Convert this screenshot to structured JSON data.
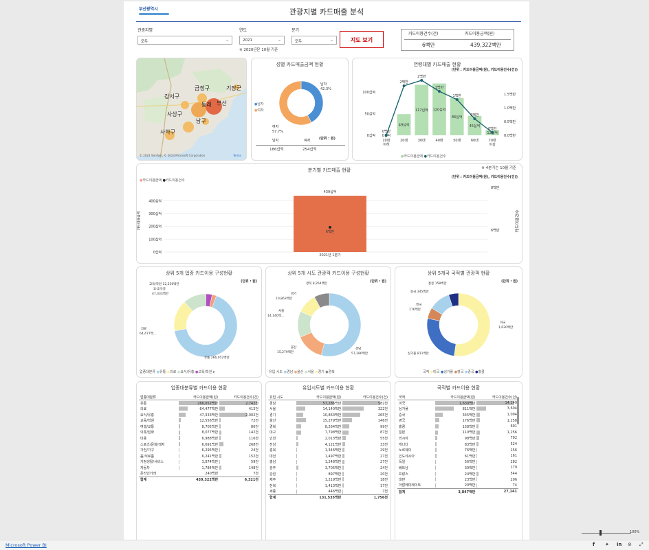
{
  "header": {
    "logo_text": "부산광역시",
    "title": "관광지별 카드매출 분석"
  },
  "filters": {
    "region_label": "관광지명",
    "region_value": "모두",
    "year_label": "연도",
    "year_value": "2021",
    "year_note": "※ 2020년은 10월 기준",
    "quarter_label": "분기",
    "quarter_value": "모두",
    "map_button": "지도 보기"
  },
  "kpi": {
    "count_label": "카드이용건수(건)",
    "amount_label": "카드이용금액(원)",
    "count_value": "6백만",
    "amount_value": "439,322백만"
  },
  "map": {
    "labels": [
      "기장군",
      "금정구",
      "강서구",
      "동래",
      "부산",
      "사상구",
      "남구",
      "사하구"
    ],
    "credit": "© 2023 TomTom, © 2023 Microsoft Corporation",
    "terms": "Terms"
  },
  "gender": {
    "title": "성별 카드매출금액 현황",
    "unit": "(단위 : 원)",
    "legend": [
      "남자",
      "여자"
    ],
    "labels": [
      "남자",
      "42.3%",
      "여자",
      "57.7%"
    ],
    "table_head": [
      "남자",
      "여자"
    ],
    "table_vals": [
      "186십억",
      "254십억"
    ],
    "chart_data": {
      "type": "pie",
      "categories": [
        "남자",
        "여자"
      ],
      "values": [
        42.3,
        57.7
      ],
      "colors": [
        "#4a8fd4",
        "#f4a65e"
      ]
    }
  },
  "age": {
    "title": "연령대별 카드매출 현황",
    "unit": "(단위 : 카드이용금액(원), 카드이용건수(건))",
    "legend": [
      "카드이용금액",
      "카드이용건수"
    ],
    "yl": [
      "100십억",
      "50십억",
      "0십억"
    ],
    "yr": [
      "1.5백만",
      "1.0백만",
      "0.5백만",
      "0.0백만"
    ],
    "chart_data": {
      "type": "bar",
      "categories": [
        "10대\n이하",
        "20대",
        "30대",
        "40대",
        "50대",
        "60대",
        "70대\n이상"
      ],
      "cat_labels": [
        "10대",
        "20대",
        "30대",
        "40대",
        "50대",
        "60대",
        "70대"
      ],
      "cat_labels2": [
        "이하",
        "",
        "",
        "",
        "",
        "",
        "이상"
      ],
      "series": [
        {
          "name": "카드이용금액",
          "values": [
            0,
            49,
            117,
            120,
            86,
            45,
            12
          ],
          "labels": [
            "0십억",
            "49십억",
            "117십억",
            "120십억",
            "86십억",
            "45십억",
            "12십억"
          ]
        },
        {
          "name": "카드이용건수",
          "values": [
            0,
            1.8,
            2.0,
            1.6,
            1.3,
            0.6,
            0.1
          ],
          "labels": [
            "0백만",
            "2백만",
            "2백만",
            "1백만",
            "1백만",
            "0백만",
            "0백만"
          ]
        }
      ],
      "ylim": [
        0,
        140
      ],
      "y2lim": [
        0,
        2.2
      ]
    }
  },
  "quarter": {
    "title": "분기별 카드매출 현황",
    "note": "※ 4분기는 10월 기준",
    "unit": "(단위 : 카드이용금액(원), 카드이용건수(건))",
    "legend": [
      "카드이용금액",
      "카드이용건수"
    ],
    "ylabel": "카드이용금액",
    "y2label": "카드이용건수",
    "yl": [
      "400십억",
      "300십억",
      "200십억",
      "100십억",
      "0십억"
    ],
    "yr": [
      "8백만",
      "6백만"
    ],
    "chart_data": {
      "type": "bar",
      "categories": [
        "2021년 1분기"
      ],
      "series": [
        {
          "name": "카드이용금액",
          "values": [
            439
          ],
          "labels": [
            "439십억"
          ]
        },
        {
          "name": "카드이용건수",
          "values": [
            6
          ],
          "labels": [
            "6백만"
          ]
        }
      ],
      "ylim": [
        0,
        450
      ]
    }
  },
  "donut1": {
    "title": "상위 5개 업종 카드이용 구성현황",
    "unit": "(단위 : 원)",
    "legend_title": "업종대분류",
    "legend": [
      "유통",
      "의료",
      "요식/유흥",
      "교육/학원"
    ],
    "labels": [
      "교육/학원 12,556백만",
      "요식/유흥",
      "47,333백만",
      "의료",
      "64,477백...",
      "유통 266,052백만"
    ],
    "chart_data": {
      "type": "pie",
      "categories": [
        "유통",
        "의료",
        "요식/유흥",
        "교육/학원",
        "여행/교통"
      ],
      "values": [
        266052,
        64477,
        47333,
        12556,
        8705
      ],
      "colors": [
        "#a8d1ec",
        "#fbf2a4",
        "#cce3cc",
        "#b04fc0",
        "#f2a07b"
      ]
    }
  },
  "donut2": {
    "title": "상위 5개 시도 관광객 카드이용 구성현황",
    "unit": "(단위 : 원)",
    "legend_title": "유입 시도",
    "legend": [
      "경남",
      "울산",
      "서울",
      "경기",
      "경북"
    ],
    "labels": [
      "경북 8,264백만",
      "경기",
      "10,863백만",
      "서울",
      "14,140백...",
      "울산",
      "15,279백만",
      "경남",
      "57,286백만"
    ],
    "chart_data": {
      "type": "pie",
      "categories": [
        "경남",
        "울산",
        "서울",
        "경기",
        "경북"
      ],
      "values": [
        57286,
        15279,
        14140,
        10863,
        8264
      ],
      "colors": [
        "#a8d1ec",
        "#f4a97a",
        "#cce3cc",
        "#fbf2a4",
        "#8a8a8a"
      ]
    }
  },
  "donut3": {
    "title": "상위 5개국 국적별 관광객 현황",
    "unit": "(단위 : 원)",
    "legend_title": "국적",
    "legend": [
      "미국",
      "싱가폴",
      "영국",
      "중국",
      "홍콩"
    ],
    "labels": [
      "홍콩 158백만",
      "중국 345백만",
      "영국",
      "176백만",
      "미국",
      "1,630백만",
      "싱가폴 811백만"
    ],
    "chart_data": {
      "type": "pie",
      "categories": [
        "미국",
        "싱가폴",
        "영국",
        "중국",
        "홍콩"
      ],
      "values": [
        1630,
        811,
        176,
        345,
        158
      ],
      "colors": [
        "#fbf2a4",
        "#3f6fc2",
        "#d4885a",
        "#a8d1ec",
        "#1f2f86"
      ]
    }
  },
  "t1": {
    "title": "업종대분류별 카드이용 현황",
    "head": [
      "업종대분류",
      "카드이용금액(원)",
      "카드이용건수(건)"
    ],
    "rows": [
      [
        "유통",
        "266,052백만",
        "2,742천",
        100,
        100
      ],
      [
        "의료",
        "64,477백만",
        "413천",
        24,
        15
      ],
      [
        "요식/유흥",
        "47,333백만",
        "2,002천",
        18,
        73
      ],
      [
        "교육/학원",
        "12,556백만",
        "72천",
        5,
        3
      ],
      [
        "여행/교통",
        "8,705백만",
        "86천",
        3,
        3
      ],
      [
        "의류/잡화",
        "8,077백만",
        "142천",
        3,
        5
      ],
      [
        "미용",
        "6,988백만",
        "116천",
        3,
        4
      ],
      [
        "스포츠/문화/레저",
        "6,691백만",
        "268천",
        3,
        10
      ],
      [
        "가전/가구",
        "6,295백만",
        "24천",
        2,
        1
      ],
      [
        "음/식료품",
        "6,241백만",
        "152천",
        2,
        6
      ],
      [
        "가정생활/서비스",
        "3,874백만",
        "59천",
        1,
        2
      ],
      [
        "자동차",
        "1,784백만",
        "148천",
        1,
        5
      ],
      [
        "온라인거래",
        "240백만",
        "7천",
        0,
        0
      ]
    ],
    "total": [
      "합계",
      "439,322백만",
      "6,321천"
    ]
  },
  "t2": {
    "title": "유입시도별 카드이용 현황",
    "head": [
      "유입 시도",
      "카드이용금액(원)",
      "카드이용건수(건)"
    ],
    "rows": [
      [
        "경남",
        "57,286백만",
        "582천",
        100,
        100
      ],
      [
        "서울",
        "14,140백만",
        "322천",
        25,
        55
      ],
      [
        "경기",
        "10,863백만",
        "265천",
        19,
        46
      ],
      [
        "울산",
        "15,279백만",
        "146천",
        27,
        25
      ],
      [
        "경북",
        "8,264백만",
        "99천",
        14,
        17
      ],
      [
        "대구",
        "7,798백만",
        "87천",
        14,
        15
      ],
      [
        "인천",
        "2,013백만",
        "55천",
        4,
        9
      ],
      [
        "전남",
        "4,121백만",
        "33천",
        7,
        6
      ],
      [
        "충북",
        "1,346백만",
        "29천",
        2,
        5
      ],
      [
        "대전",
        "1,497백만",
        "27천",
        3,
        5
      ],
      [
        "충남",
        "1,248백만",
        "27천",
        2,
        5
      ],
      [
        "광주",
        "3,705백만",
        "24천",
        6,
        4
      ],
      [
        "강원",
        "897백만",
        "20천",
        2,
        3
      ],
      [
        "제주",
        "1,219백만",
        "18천",
        2,
        3
      ],
      [
        "전북",
        "1,413백만",
        "17천",
        2,
        3
      ],
      [
        "세종",
        "446백만",
        "7천",
        1,
        1
      ]
    ],
    "total": [
      "합계",
      "131,535백만",
      "1,756천"
    ]
  },
  "t3": {
    "title": "국적별 카드이용 현황",
    "head": [
      "국적",
      "카드이용금액(원)",
      "카드이용건수(건)"
    ],
    "rows": [
      [
        "미국",
        "1,630백만",
        "14,149",
        100,
        100
      ],
      [
        "싱가폴",
        "811백만",
        "3,604",
        50,
        25
      ],
      [
        "중국",
        "345백만",
        "1,094",
        21,
        8
      ],
      [
        "영국",
        "176백만",
        "1,258",
        11,
        9
      ],
      [
        "홍콩",
        "158백만",
        "691",
        10,
        5
      ],
      [
        "일본",
        "110백만",
        "1,256",
        7,
        9
      ],
      [
        "러시아",
        "98백만",
        "792",
        6,
        6
      ],
      [
        "캐나다",
        "83백만",
        "524",
        5,
        4
      ],
      [
        "노르웨이",
        "76백만",
        "156",
        5,
        1
      ],
      [
        "인도네시아",
        "61백만",
        "161",
        4,
        1
      ],
      [
        "독일",
        "56백만",
        "282",
        3,
        2
      ],
      [
        "베트남",
        "30백만",
        "179",
        2,
        1
      ],
      [
        "프랑스",
        "24백만",
        "544",
        1,
        4
      ],
      [
        "대만",
        "23백만",
        "206",
        1,
        1
      ],
      [
        "아랍에미레이트",
        "20백만",
        "74",
        1,
        1
      ]
    ],
    "total": [
      "합계",
      "3,847백만",
      "27,141"
    ]
  },
  "footer": {
    "brand": "Microsoft Power BI",
    "zoom": "100%"
  }
}
